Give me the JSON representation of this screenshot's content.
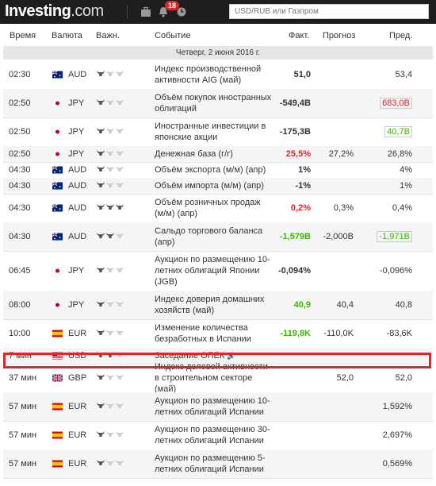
{
  "header": {
    "logo_main": "Investing",
    "logo_domain": ".com",
    "notification_count": "18",
    "search_placeholder": "USD/RUB или Газпром"
  },
  "columns": [
    "Время",
    "Валюта",
    "Важн.",
    "Событие",
    "Факт.",
    "Прогноз",
    "Пред."
  ],
  "date_label": "Четверг, 2 июня 2016 г.",
  "rows": [
    {
      "time": "02:30",
      "currency": "AUD",
      "flag": "au",
      "importance": 1,
      "event": "Индекс производственной активности AIG (май)",
      "actual": "51,0",
      "actual_color": "black",
      "forecast": "",
      "previous": "53,4",
      "prev_color": "black"
    },
    {
      "time": "02:50",
      "currency": "JPY",
      "flag": "jp",
      "importance": 1,
      "event": "Объём покупок иностранных облигаций",
      "actual": "-549,4B",
      "actual_color": "black",
      "forecast": "",
      "previous": "683,0B",
      "prev_color": "red"
    },
    {
      "time": "02:50",
      "currency": "JPY",
      "flag": "jp",
      "importance": 1,
      "event": "Иностранные инвестиции в японские акции",
      "actual": "-175,3B",
      "actual_color": "black",
      "forecast": "",
      "previous": "40,7B",
      "prev_color": "green"
    },
    {
      "time": "02:50",
      "currency": "JPY",
      "flag": "jp",
      "importance": 1,
      "event": "Денежная база (г/г)",
      "actual": "25,5%",
      "actual_color": "red",
      "forecast": "27,2%",
      "previous": "26,8%",
      "prev_color": "black"
    },
    {
      "time": "04:30",
      "currency": "AUD",
      "flag": "au",
      "importance": 1,
      "event": "Объём экспорта (м/м) (апр)",
      "actual": "1%",
      "actual_color": "black",
      "forecast": "",
      "previous": "4%",
      "prev_color": "black"
    },
    {
      "time": "04:30",
      "currency": "AUD",
      "flag": "au",
      "importance": 1,
      "event": "Объём импорта (м/м) (апр)",
      "actual": "-1%",
      "actual_color": "black",
      "forecast": "",
      "previous": "1%",
      "prev_color": "black"
    },
    {
      "time": "04:30",
      "currency": "AUD",
      "flag": "au",
      "importance": 3,
      "event": "Объём розничных продаж (м/м) (апр)",
      "actual": "0,2%",
      "actual_color": "red",
      "forecast": "0,3%",
      "previous": "0,4%",
      "prev_color": "black"
    },
    {
      "time": "04:30",
      "currency": "AUD",
      "flag": "au",
      "importance": 2,
      "event": "Сальдо торгового баланса (апр)",
      "actual": "-1,579B",
      "actual_color": "green",
      "forecast": "-2,000B",
      "previous": "-1,971B",
      "prev_color": "green"
    },
    {
      "time": "06:45",
      "currency": "JPY",
      "flag": "jp",
      "importance": 1,
      "event": "Аукцион по размещению 10-летних облигаций Японии (JGB)",
      "actual": "-0,094%",
      "actual_color": "black",
      "forecast": "",
      "previous": "-0,096%",
      "prev_color": "black"
    },
    {
      "time": "08:00",
      "currency": "JPY",
      "flag": "jp",
      "importance": 1,
      "event": "Индекс доверия домашних хозяйств (май)",
      "actual": "40,9",
      "actual_color": "green",
      "forecast": "40,4",
      "previous": "40,8",
      "prev_color": "black"
    },
    {
      "time": "10:00",
      "currency": "EUR",
      "flag": "es",
      "importance": 1,
      "event": "Изменение количества безработных в Испании",
      "actual": "-119,8K",
      "actual_color": "green",
      "forecast": "-110,0K",
      "previous": "-83,6K",
      "prev_color": "black"
    },
    {
      "time": "7 мин",
      "currency": "USD",
      "flag": "us",
      "importance": 2,
      "event": "Заседание ОПЕК",
      "actual": "",
      "actual_color": "black",
      "forecast": "",
      "previous": "",
      "prev_color": "black",
      "speaker": true
    },
    {
      "time": "37 мин",
      "currency": "GBP",
      "flag": "gb",
      "importance": 1,
      "event": "Индекс деловой активности в строительном секторе (май)",
      "actual": "",
      "actual_color": "black",
      "forecast": "52,0",
      "previous": "52,0",
      "prev_color": "black"
    },
    {
      "time": "57 мин",
      "currency": "EUR",
      "flag": "es",
      "importance": 1,
      "event": "Аукцион по размещению 10-летних облигаций Испании",
      "actual": "",
      "actual_color": "black",
      "forecast": "",
      "previous": "1,592%",
      "prev_color": "black"
    },
    {
      "time": "57 мин",
      "currency": "EUR",
      "flag": "es",
      "importance": 1,
      "event": "Аукцион по размещению 30-летних облигаций Испании",
      "actual": "",
      "actual_color": "black",
      "forecast": "",
      "previous": "2,697%",
      "prev_color": "black"
    },
    {
      "time": "57 мин",
      "currency": "EUR",
      "flag": "es",
      "importance": 1,
      "event": "Аукцион по размещению 5-летних облигаций Испании",
      "actual": "",
      "actual_color": "black",
      "forecast": "",
      "previous": "0,569%",
      "prev_color": "black"
    }
  ]
}
